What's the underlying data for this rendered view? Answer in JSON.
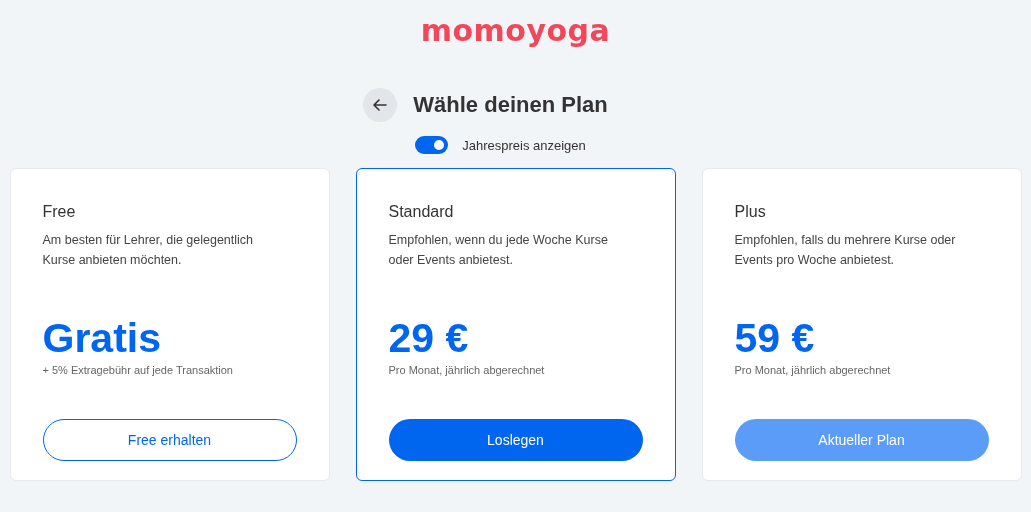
{
  "logo": "momoyoga",
  "header": {
    "title": "Wähle deinen Plan"
  },
  "toggle": {
    "label": "Jahrespreis anzeigen",
    "on": true
  },
  "plans": [
    {
      "name": "Free",
      "description": "Am besten für Lehrer, die gelegentlich Kurse anbieten möchten.",
      "price": "Gratis",
      "note": "+ 5% Extragebühr auf jede Transaktion",
      "selected": false,
      "button": {
        "label": "Free erhalten",
        "kind": "outline",
        "disabled": false
      }
    },
    {
      "name": "Standard",
      "description": "Empfohlen, wenn du jede Woche Kurse oder Events anbietest.",
      "price": "29 €",
      "note": "Pro Monat, jährlich abgerechnet",
      "selected": true,
      "button": {
        "label": "Loslegen",
        "kind": "primary",
        "disabled": false
      }
    },
    {
      "name": "Plus",
      "description": "Empfohlen, falls du mehrere Kurse oder Events pro Woche anbietest.",
      "price": "59 €",
      "note": "Pro Monat, jährlich abgerechnet",
      "selected": false,
      "button": {
        "label": "Aktueller Plan",
        "kind": "primary",
        "disabled": true
      }
    }
  ]
}
